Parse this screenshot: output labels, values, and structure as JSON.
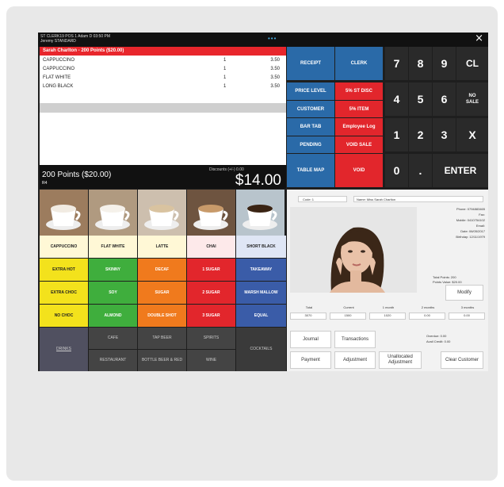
{
  "topbar": {
    "line1": "ST CLERK19  POS 1  Adam D  03:50 PM",
    "line2": "Jeremy  STANDARD",
    "dots": "•••",
    "close": "×"
  },
  "customer_bar": "Sarah Charlton  -  200 Points ($20.00)",
  "order_items": [
    {
      "name": "CAPPUCCINO",
      "qty": "1",
      "price": "3.50"
    },
    {
      "name": "CAPPUCCINO",
      "qty": "1",
      "price": "3.50"
    },
    {
      "name": "FLAT WHITE",
      "qty": "1",
      "price": "3.50"
    },
    {
      "name": "LONG BLACK",
      "qty": "1",
      "price": "3.50"
    }
  ],
  "totals": {
    "points": "200 Points ($20.00)",
    "sub": "R4",
    "discounts": "Discounts (+/-)   0.00",
    "amount": "$14.00"
  },
  "photo_tiles": [
    {
      "icon": "cappuccino-cup-photo",
      "cup": "#f1ebe2",
      "bg": "#9c7c5e"
    },
    {
      "icon": "flat-white-cup-photo",
      "cup": "#f5f1ea",
      "bg": "#b09a80"
    },
    {
      "icon": "latte-glass-photo",
      "cup": "#d9c3a0",
      "bg": "#cdbfae"
    },
    {
      "icon": "chai-cup-photo",
      "cup": "#c89a6a",
      "bg": "#6e5440"
    },
    {
      "icon": "short-black-cup-photo",
      "cup": "#3a2414",
      "bg": "#b8c4cc"
    }
  ],
  "product_rows": [
    [
      {
        "label": "CAPPUCCINO",
        "bg": "#fff8d6",
        "fg": "#222"
      },
      {
        "label": "FLAT WHITE",
        "bg": "#fff8d6",
        "fg": "#222"
      },
      {
        "label": "LATTE",
        "bg": "#fff8d6",
        "fg": "#222"
      },
      {
        "label": "CHAI",
        "bg": "#fde9ea",
        "fg": "#222"
      },
      {
        "label": "SHORT BLACK",
        "bg": "#dfe6f5",
        "fg": "#222"
      }
    ],
    [
      {
        "label": "EXTRA HOT",
        "bg": "#f3e21c",
        "fg": "#222"
      },
      {
        "label": "SKINNY",
        "bg": "#3fae3d",
        "fg": "#fff"
      },
      {
        "label": "DECAF",
        "bg": "#f07a1d",
        "fg": "#fff"
      },
      {
        "label": "1 SUGAR",
        "bg": "#e2262c",
        "fg": "#fff"
      },
      {
        "label": "TAKEAWAY",
        "bg": "#3a5ca8",
        "fg": "#fff"
      }
    ],
    [
      {
        "label": "EXTRA CHOC",
        "bg": "#f3e21c",
        "fg": "#222"
      },
      {
        "label": "SOY",
        "bg": "#3fae3d",
        "fg": "#fff"
      },
      {
        "label": "SUGAR",
        "bg": "#f07a1d",
        "fg": "#fff"
      },
      {
        "label": "2 SUGAR",
        "bg": "#e2262c",
        "fg": "#fff"
      },
      {
        "label": "MARSH MALLOW",
        "bg": "#3a5ca8",
        "fg": "#fff"
      }
    ],
    [
      {
        "label": "NO CHOC",
        "bg": "#f3e21c",
        "fg": "#222"
      },
      {
        "label": "ALMOND",
        "bg": "#3fae3d",
        "fg": "#fff"
      },
      {
        "label": "DOUBLE SHOT",
        "bg": "#f07a1d",
        "fg": "#fff"
      },
      {
        "label": "3 SUGAR",
        "bg": "#e2262c",
        "fg": "#fff"
      },
      {
        "label": "EQUAL",
        "bg": "#3a5ca8",
        "fg": "#fff"
      }
    ]
  ],
  "categories": {
    "drinks": "DRINKS",
    "cafe": "CAFE",
    "tap_beer": "TAP BEER",
    "spirits": "SPIRITS",
    "cocktails": "COCKTAILS",
    "restaurant": "RESTAURANT",
    "bottle_beer_red": "BOTTLE BEER & RED",
    "wine": "WINE"
  },
  "function_buttons": [
    {
      "label": "RECEIPT",
      "bg": "#2a6aa8"
    },
    {
      "label": "CLERK",
      "bg": "#2a6aa8"
    },
    {
      "label": "PRICE LEVEL",
      "bg": "#2a6aa8"
    },
    {
      "label": "5% ST DISC",
      "bg": "#e2262c"
    },
    {
      "label": "CUSTOMER",
      "bg": "#2a6aa8"
    },
    {
      "label": "5% ITEM",
      "bg": "#e2262c"
    },
    {
      "label": "BAR TAB",
      "bg": "#2a6aa8"
    },
    {
      "label": "Employee Log",
      "bg": "#e2262c"
    },
    {
      "label": "PENDING",
      "bg": "#2a6aa8"
    },
    {
      "label": "VOID SALE",
      "bg": "#e2262c"
    },
    {
      "label": "TABLE MAP",
      "bg": "#2a6aa8"
    },
    {
      "label": "VOID",
      "bg": "#e2262c"
    }
  ],
  "keypad": {
    "k7": "7",
    "k8": "8",
    "k9": "9",
    "cl": "CL",
    "k4": "4",
    "k5": "5",
    "k6": "6",
    "no_sale": "NO SALE",
    "k1": "1",
    "k2": "2",
    "k3": "3",
    "x": "X",
    "k0": "0",
    "dot": ".",
    "enter": "ENTER"
  },
  "customer_panel": {
    "code": "Code: 1",
    "name_line": "Name: Miss Sarah Charlton",
    "info": [
      "Phone: 0794883465",
      "Fax:",
      "Mobile: 0410754102",
      "Email:",
      "Date: 06/05/2017",
      "Birthday: 12/11/1979"
    ],
    "points_line": "Total Points: 200",
    "sales_line": "Points Value: $20.00",
    "modify": "Modify",
    "stats_headers": [
      "Total",
      "Current",
      "1 month",
      "2 months",
      "3 months"
    ],
    "stats_values": [
      "3070",
      "1500",
      "1020",
      "0.00",
      "0.00"
    ],
    "journal": "Journal",
    "transactions": "Transactions",
    "balance": "Overdue: 0.00",
    "credit": "Avail Credit: 0.00",
    "payment": "Payment",
    "adjustment": "Adjustment",
    "unallocated": "Unallocated Adjustment",
    "clear": "Clear Customer"
  }
}
